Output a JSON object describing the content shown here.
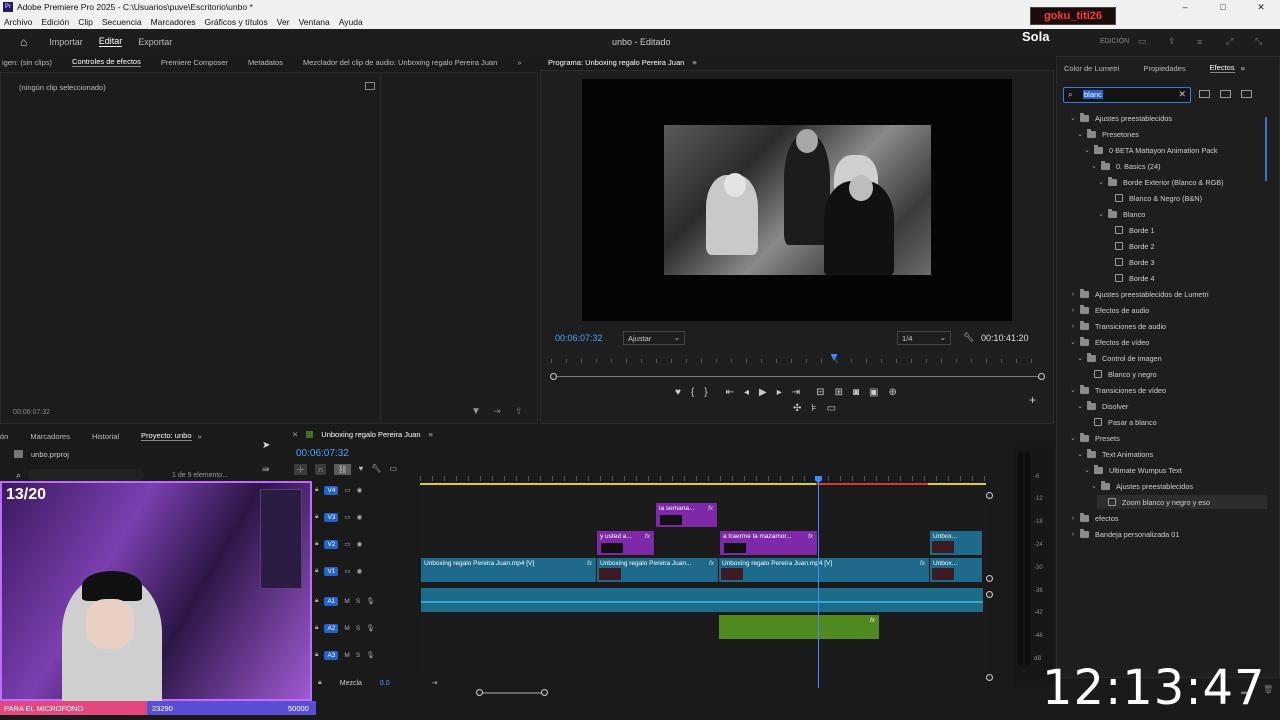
{
  "window": {
    "title": "Adobe Premiere Pro 2025 - C:\\Usuarios\\puve\\Escritorio\\unbo *",
    "app_icon": "Pr",
    "controls": [
      "–",
      "□",
      "✕"
    ]
  },
  "menubar": [
    "Archivo",
    "Edición",
    "Clip",
    "Secuencia",
    "Marcadores",
    "Gráficos y títulos",
    "Ver",
    "Ventana",
    "Ayuda"
  ],
  "appbar": {
    "tabs": [
      "Importar",
      "Editar",
      "Exportar"
    ],
    "project_title": "unbo - Editado",
    "edition_label": "EDICIÓN"
  },
  "overlay": {
    "streamer_tag": "goku_titi26",
    "sola_label": "Sola",
    "mic_label": "PARA EL MICROFONO",
    "mic_current": "23290",
    "mic_goal": "50000",
    "mic_progress": 0.4658,
    "counter": "13/20",
    "clock": "12:13:47"
  },
  "source_panel": {
    "tabs": [
      "igen: (sin clips)",
      "Controles de efectos",
      "Premiere Composer",
      "Metadatos",
      "Mezclador del clip de audio: Unboxing regalo Pereira Juan"
    ],
    "empty_text": "(ningún clip seleccionado)",
    "timecode": "00:06:07:32"
  },
  "program_monitor": {
    "title": "Programa: Unboxing regalo Pereira Juan",
    "timecode": "00:06:07:32",
    "fit": "Ajustar",
    "resolution": "1/4",
    "duration": "00:10:41:20",
    "playhead_fraction": 0.572
  },
  "effects_panel": {
    "tabs": [
      "Color de Lumetri",
      "Propiedades",
      "Efectos"
    ],
    "search_value": "blanc",
    "tree": [
      {
        "label": "Ajustes preestablecidos",
        "depth": 0,
        "type": "folder",
        "open": true
      },
      {
        "label": "Presetones",
        "depth": 1,
        "type": "folder",
        "open": true
      },
      {
        "label": "0 BETA Mattayon Animation Pack",
        "depth": 2,
        "type": "folder",
        "open": true
      },
      {
        "label": "0. Basics (24)",
        "depth": 3,
        "type": "folder",
        "open": true
      },
      {
        "label": "Borde Exterior (Blanco & RGB)",
        "depth": 4,
        "type": "folder",
        "open": true
      },
      {
        "label": "Blanco & Negro (B&N)",
        "depth": 5,
        "type": "fx"
      },
      {
        "label": "Blanco",
        "depth": 4,
        "type": "folder",
        "open": true
      },
      {
        "label": "Borde 1",
        "depth": 5,
        "type": "fx"
      },
      {
        "label": "Borde 2",
        "depth": 5,
        "type": "fx"
      },
      {
        "label": "Borde 3",
        "depth": 5,
        "type": "fx"
      },
      {
        "label": "Borde 4",
        "depth": 5,
        "type": "fx"
      },
      {
        "label": "Ajustes preestablecidos de Lumetri",
        "depth": 0,
        "type": "folder",
        "open": false
      },
      {
        "label": "Efectos de audio",
        "depth": 0,
        "type": "folder",
        "open": false
      },
      {
        "label": "Transiciones de audio",
        "depth": 0,
        "type": "folder",
        "open": false
      },
      {
        "label": "Efectos de vídeo",
        "depth": 0,
        "type": "folder",
        "open": true
      },
      {
        "label": "Control de imagen",
        "depth": 1,
        "type": "folder",
        "open": true
      },
      {
        "label": "Blanco y negro",
        "depth": 2,
        "type": "fx"
      },
      {
        "label": "Transiciones de vídeo",
        "depth": 0,
        "type": "folder",
        "open": true
      },
      {
        "label": "Disolver",
        "depth": 1,
        "type": "folder",
        "open": true
      },
      {
        "label": "Pasar a blanco",
        "depth": 2,
        "type": "fx"
      },
      {
        "label": "Presets",
        "depth": 0,
        "type": "folder",
        "open": true
      },
      {
        "label": "Text Animations",
        "depth": 1,
        "type": "folder",
        "open": true
      },
      {
        "label": "Ultimate Wumpus Text",
        "depth": 2,
        "type": "folder",
        "open": true
      },
      {
        "label": "Ajustes preestablecidos",
        "depth": 3,
        "type": "folder",
        "open": true
      },
      {
        "label": "Zoom blanco y negro y eso",
        "depth": 4,
        "type": "fx",
        "selected": true
      },
      {
        "label": "efectos",
        "depth": 0,
        "type": "folder",
        "open": false
      },
      {
        "label": "Bandeja personalizada 01",
        "depth": 0,
        "type": "folder",
        "open": false
      }
    ]
  },
  "project_panel": {
    "tabs": [
      "ón",
      "Marcadores",
      "Historial",
      "Proyecto: unbo"
    ],
    "file": "unbo.prproj",
    "count": "1 de 9 elemento..."
  },
  "timeline": {
    "sequence": "Unboxing regalo Pereira Juan",
    "timecode": "00:06:07:32",
    "playhead_fraction": 0.703,
    "mix_label": "Mezcla",
    "mix_value": "0.0",
    "video_tracks": [
      "V4",
      "V3",
      "V2",
      "V1"
    ],
    "audio_tracks": [
      "A1",
      "A2",
      "A3"
    ],
    "clips": {
      "v3": "la semana...",
      "v2a": "y usted a...",
      "v2b": "a traerme la mazamor...",
      "v2c": "Unbox...",
      "v1a": "Unboxing regalo Pereira Juan.mp4 [V]",
      "v1b": "Unboxing regalo Pereira Juan...",
      "v1c": "Unboxing regalo Pereira Juan.mp4 [V]",
      "v1d": "Unbox..."
    },
    "fx_label": "fx"
  },
  "meter_labels": [
    "-6",
    "-12",
    "-18",
    "-24",
    "-30",
    "-36",
    "-42",
    "-48",
    "dB"
  ]
}
